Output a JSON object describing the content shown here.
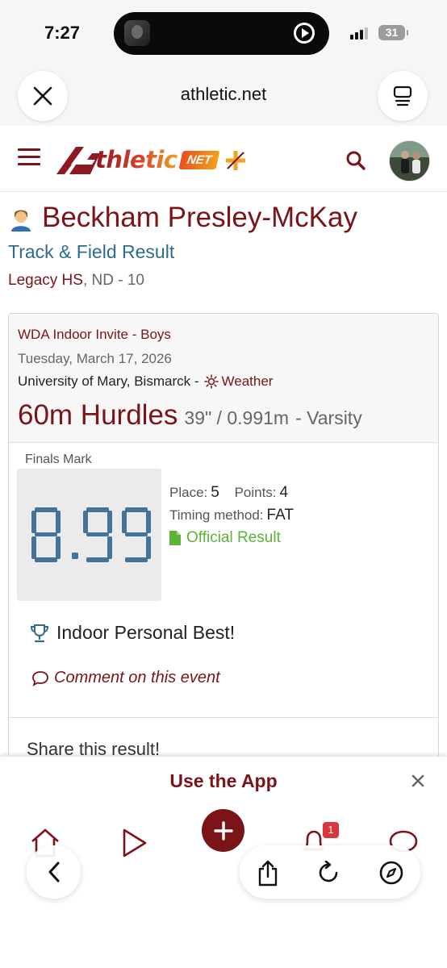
{
  "status_bar": {
    "time": "7:27",
    "battery": "31"
  },
  "browser": {
    "url": "athletic.net",
    "close_icon": "close-icon",
    "tabs_icon": "tab-overview-icon"
  },
  "site": {
    "logo_text": "thletic",
    "logo_net": "NET",
    "brand_color": "#7a1418"
  },
  "athlete": {
    "name": "Beckham Presley-McKay",
    "result_type": "Track & Field Result",
    "school": "Legacy HS",
    "state_grade": ", ND - 10"
  },
  "result": {
    "meet_name": "WDA Indoor Invite - Boys",
    "date": "Tuesday, March 17, 2026",
    "location": "University of Mary, Bismarck -",
    "weather_label": "Weather",
    "event": "60m Hurdles",
    "spec": "39\" / 0.991m",
    "level": "- Varsity",
    "finals_label": "Finals Mark",
    "mark": "8.99",
    "place_label": "Place:",
    "place": "5",
    "points_label": "Points:",
    "points": "4",
    "timing_label": "Timing method:",
    "timing": "FAT",
    "official_label": "Official Result",
    "pb_label": "Indoor Personal Best!",
    "comment_label": "Comment on this event",
    "share_label": "Share this result!"
  },
  "app_banner": {
    "title": "Use the App"
  },
  "app_nav": {
    "notification_count": "1"
  },
  "colors": {
    "accent": "#7a1418",
    "link_blue": "#2f6b8f",
    "official_green": "#5bb337",
    "mark_digits": "#43729a"
  }
}
